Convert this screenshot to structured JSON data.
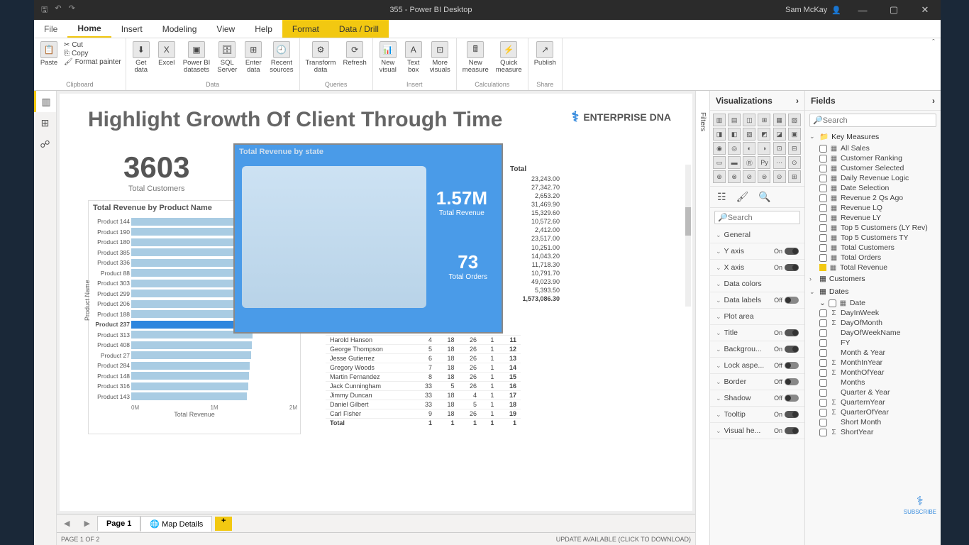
{
  "titlebar": {
    "title": "355 - Power BI Desktop",
    "user": "Sam McKay"
  },
  "menu": {
    "file": "File",
    "tabs": [
      "Home",
      "Insert",
      "Modeling",
      "View",
      "Help",
      "Format",
      "Data / Drill"
    ],
    "active": "Home"
  },
  "ribbon": {
    "clipboard": {
      "label": "Clipboard",
      "paste": "Paste",
      "cut": "Cut",
      "copy": "Copy",
      "painter": "Format painter"
    },
    "data": {
      "label": "Data",
      "get": "Get\ndata",
      "excel": "Excel",
      "pbi": "Power BI\ndatasets",
      "sql": "SQL\nServer",
      "enter": "Enter\ndata",
      "recent": "Recent\nsources"
    },
    "queries": {
      "label": "Queries",
      "transform": "Transform\ndata",
      "refresh": "Refresh"
    },
    "insert": {
      "label": "Insert",
      "newvis": "New\nvisual",
      "textbox": "Text\nbox",
      "more": "More\nvisuals"
    },
    "calc": {
      "label": "Calculations",
      "newmeasure": "New\nmeasure",
      "quick": "Quick\nmeasure"
    },
    "share": {
      "label": "Share",
      "publish": "Publish"
    }
  },
  "report": {
    "title": "Highlight Growth Of Client Through Time",
    "logo": "ENTERPRISE DNA",
    "kpi_customers": {
      "value": "3603",
      "label": "Total Customers"
    },
    "bar": {
      "title": "Total Revenue by Product Name",
      "ylabel": "Product Name",
      "xlabel": "Total Revenue",
      "xticks": [
        "0M",
        "1M",
        "2M"
      ],
      "rows": [
        {
          "name": "Product 144",
          "v": 195
        },
        {
          "name": "Product 190",
          "v": 192
        },
        {
          "name": "Product 180",
          "v": 190
        },
        {
          "name": "Product 385",
          "v": 188
        },
        {
          "name": "Product 336",
          "v": 185
        },
        {
          "name": "Product 88",
          "v": 183
        },
        {
          "name": "Product 303",
          "v": 180
        },
        {
          "name": "Product 299",
          "v": 178
        },
        {
          "name": "Product 206",
          "v": 176
        },
        {
          "name": "Product 188",
          "v": 175
        },
        {
          "name": "Product 237",
          "v": 173,
          "hl": true
        },
        {
          "name": "Product 313",
          "v": 171
        },
        {
          "name": "Product 408",
          "v": 170
        },
        {
          "name": "Product 27",
          "v": 169
        },
        {
          "name": "Product 284",
          "v": 167
        },
        {
          "name": "Product 148",
          "v": 166
        },
        {
          "name": "Product 316",
          "v": 165
        },
        {
          "name": "Product 143",
          "v": 163
        }
      ]
    },
    "map": {
      "title": "Total Revenue by state",
      "rev": {
        "value": "1.57M",
        "label": "Total Revenue"
      },
      "ord": {
        "value": "73",
        "label": "Total Orders"
      }
    },
    "totals": {
      "header": "Total",
      "rows": [
        "23,243.00",
        "27,342.70",
        "2,653.20",
        "31,469.90",
        "15,329.60",
        "10,572.60",
        "2,412.00",
        "23,517.00",
        "10,251.00",
        "14,043.20",
        "11,718.30",
        "10,791.70",
        "49,023.90",
        "5,393.50"
      ],
      "grand": "1,573,086.30"
    },
    "table": {
      "rows": [
        {
          "name": "Harold Hanson",
          "c1": "4",
          "c2": "18",
          "c3": "26",
          "c4": "1",
          "c5": "11"
        },
        {
          "name": "George Thompson",
          "c1": "5",
          "c2": "18",
          "c3": "26",
          "c4": "1",
          "c5": "12"
        },
        {
          "name": "Jesse Gutierrez",
          "c1": "6",
          "c2": "18",
          "c3": "26",
          "c4": "1",
          "c5": "13"
        },
        {
          "name": "Gregory Woods",
          "c1": "7",
          "c2": "18",
          "c3": "26",
          "c4": "1",
          "c5": "14"
        },
        {
          "name": "Martin Fernandez",
          "c1": "8",
          "c2": "18",
          "c3": "26",
          "c4": "1",
          "c5": "15"
        },
        {
          "name": "Jack Cunningham",
          "c1": "33",
          "c2": "5",
          "c3": "26",
          "c4": "1",
          "c5": "16"
        },
        {
          "name": "Jimmy Duncan",
          "c1": "33",
          "c2": "18",
          "c3": "4",
          "c4": "1",
          "c5": "17"
        },
        {
          "name": "Daniel Gilbert",
          "c1": "33",
          "c2": "18",
          "c3": "5",
          "c4": "1",
          "c5": "18"
        },
        {
          "name": "Carl Fisher",
          "c1": "9",
          "c2": "18",
          "c3": "26",
          "c4": "1",
          "c5": "19"
        }
      ],
      "total_row": {
        "name": "Total",
        "c1": "1",
        "c2": "1",
        "c3": "1",
        "c4": "1",
        "c5": "1"
      }
    }
  },
  "pages": {
    "page1": "Page 1",
    "page2": "Map Details",
    "add": "+"
  },
  "status": {
    "left": "PAGE 1 OF 2",
    "right": "UPDATE AVAILABLE (CLICK TO DOWNLOAD)"
  },
  "panes": {
    "viz_title": "Visualizations",
    "fields_title": "Fields",
    "filters": "Filters",
    "search": "Search",
    "format_sections": [
      {
        "name": "General",
        "toggle": null
      },
      {
        "name": "Y axis",
        "toggle": "On"
      },
      {
        "name": "X axis",
        "toggle": "On"
      },
      {
        "name": "Data colors",
        "toggle": null
      },
      {
        "name": "Data labels",
        "toggle": "Off"
      },
      {
        "name": "Plot area",
        "toggle": null
      },
      {
        "name": "Title",
        "toggle": "On"
      },
      {
        "name": "Backgrou...",
        "toggle": "On"
      },
      {
        "name": "Lock aspe...",
        "toggle": "Off"
      },
      {
        "name": "Border",
        "toggle": "Off"
      },
      {
        "name": "Shadow",
        "toggle": "Off"
      },
      {
        "name": "Tooltip",
        "toggle": "On"
      },
      {
        "name": "Visual he...",
        "toggle": "On"
      }
    ],
    "field_groups": [
      {
        "name": "Key Measures",
        "expanded": true,
        "icon": "📁",
        "items": [
          {
            "name": "All Sales",
            "ico": "▦"
          },
          {
            "name": "Customer Ranking",
            "ico": "▦"
          },
          {
            "name": "Customer Selected",
            "ico": "▦"
          },
          {
            "name": "Daily Revenue Logic",
            "ico": "▦"
          },
          {
            "name": "Date Selection",
            "ico": "▦"
          },
          {
            "name": "Revenue 2 Qs Ago",
            "ico": "▦"
          },
          {
            "name": "Revenue LQ",
            "ico": "▦"
          },
          {
            "name": "Revenue LY",
            "ico": "▦"
          },
          {
            "name": "Top 5 Customers (LY Rev)",
            "ico": "▦"
          },
          {
            "name": "Top 5 Customers TY",
            "ico": "▦"
          },
          {
            "name": "Total Customers",
            "ico": "▦"
          },
          {
            "name": "Total Orders",
            "ico": "▦"
          },
          {
            "name": "Total Revenue",
            "ico": "▦",
            "checked": true
          }
        ]
      },
      {
        "name": "Customers",
        "expanded": false,
        "icon": "▦"
      },
      {
        "name": "Dates",
        "expanded": true,
        "icon": "▦",
        "items": [
          {
            "name": "Date",
            "ico": "▦",
            "sub": true
          },
          {
            "name": "DayInWeek",
            "ico": "Σ"
          },
          {
            "name": "DayOfMonth",
            "ico": "Σ"
          },
          {
            "name": "DayOfWeekName",
            "ico": ""
          },
          {
            "name": "FY",
            "ico": ""
          },
          {
            "name": "Month & Year",
            "ico": ""
          },
          {
            "name": "MonthInYear",
            "ico": "Σ"
          },
          {
            "name": "MonthOfYear",
            "ico": "Σ"
          },
          {
            "name": "Months",
            "ico": ""
          },
          {
            "name": "Quarter & Year",
            "ico": ""
          },
          {
            "name": "QuarternYear",
            "ico": "Σ"
          },
          {
            "name": "QuarterOfYear",
            "ico": "Σ"
          },
          {
            "name": "Short Month",
            "ico": ""
          },
          {
            "name": "ShortYear",
            "ico": "Σ"
          }
        ]
      }
    ]
  },
  "chart_data": {
    "type": "bar",
    "title": "Total Revenue by Product Name",
    "xlabel": "Total Revenue",
    "ylabel": "Product Name",
    "xlim": [
      0,
      2000000
    ],
    "categories": [
      "Product 144",
      "Product 190",
      "Product 180",
      "Product 385",
      "Product 336",
      "Product 88",
      "Product 303",
      "Product 299",
      "Product 206",
      "Product 188",
      "Product 237",
      "Product 313",
      "Product 408",
      "Product 27",
      "Product 284",
      "Product 148",
      "Product 316",
      "Product 143"
    ],
    "values": [
      1950000,
      1920000,
      1900000,
      1880000,
      1850000,
      1830000,
      1800000,
      1780000,
      1760000,
      1750000,
      1730000,
      1710000,
      1700000,
      1690000,
      1670000,
      1660000,
      1650000,
      1630000
    ],
    "highlighted": "Product 237"
  }
}
